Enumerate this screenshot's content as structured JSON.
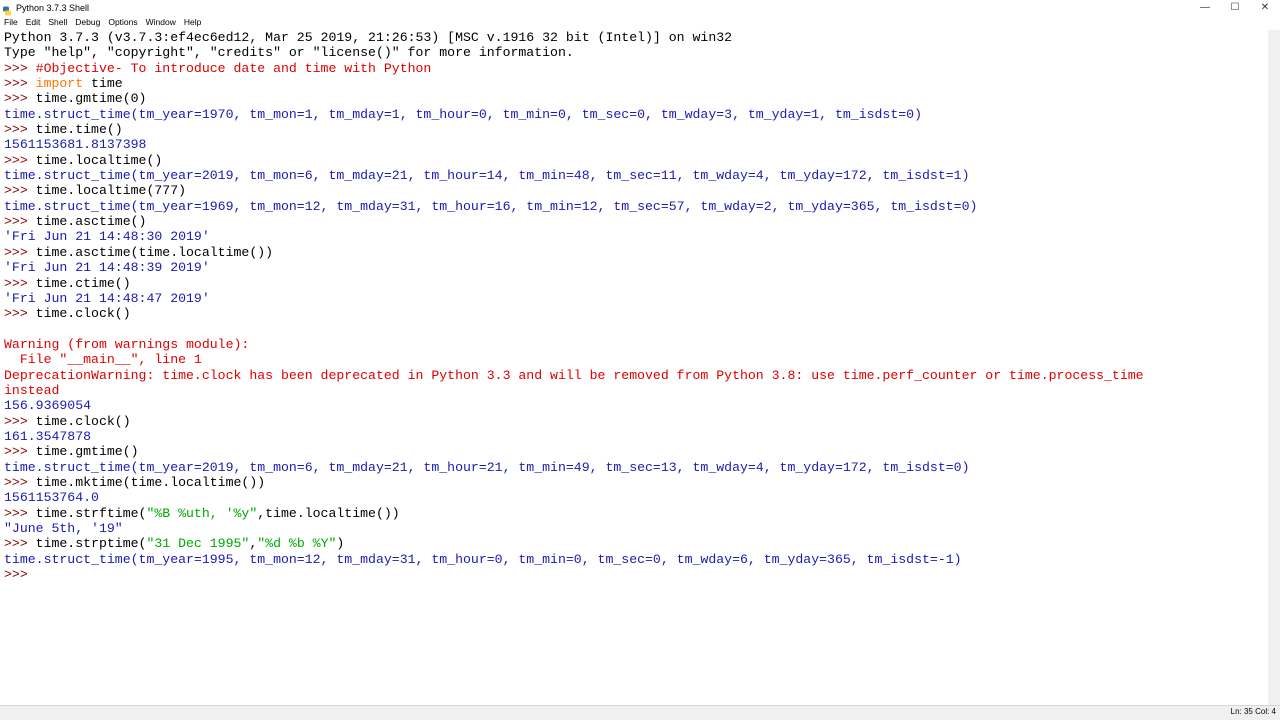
{
  "window": {
    "title": "Python 3.7.3 Shell",
    "controls": {
      "minimize": "—",
      "maximize": "☐",
      "close": "✕"
    }
  },
  "menu": [
    "File",
    "Edit",
    "Shell",
    "Debug",
    "Options",
    "Window",
    "Help"
  ],
  "shell": {
    "lines": [
      [
        {
          "t": "Python 3.7.3 (v3.7.3:ef4ec6ed12, Mar 25 2019, 21:26:53) [MSC v.1916 32 bit (Intel)] on win32",
          "c": ""
        }
      ],
      [
        {
          "t": "Type \"help\", \"copyright\", \"credits\" or \"license()\" for more information.",
          "c": ""
        }
      ],
      [
        {
          "t": ">>> ",
          "c": "prompt"
        },
        {
          "t": "#Objective- To introduce date and time with Python",
          "c": "cmt"
        }
      ],
      [
        {
          "t": ">>> ",
          "c": "prompt"
        },
        {
          "t": "import",
          "c": "kw"
        },
        {
          "t": " time",
          "c": ""
        }
      ],
      [
        {
          "t": ">>> ",
          "c": "prompt"
        },
        {
          "t": "time.gmtime(0)",
          "c": ""
        }
      ],
      [
        {
          "t": "time.struct_time(tm_year=1970, tm_mon=1, tm_mday=1, tm_hour=0, tm_min=0, tm_sec=0, tm_wday=3, tm_yday=1, tm_isdst=0)",
          "c": "out"
        }
      ],
      [
        {
          "t": ">>> ",
          "c": "prompt"
        },
        {
          "t": "time.time()",
          "c": ""
        }
      ],
      [
        {
          "t": "1561153681.8137398",
          "c": "out"
        }
      ],
      [
        {
          "t": ">>> ",
          "c": "prompt"
        },
        {
          "t": "time.localtime()",
          "c": ""
        }
      ],
      [
        {
          "t": "time.struct_time(tm_year=2019, tm_mon=6, tm_mday=21, tm_hour=14, tm_min=48, tm_sec=11, tm_wday=4, tm_yday=172, tm_isdst=1)",
          "c": "out"
        }
      ],
      [
        {
          "t": ">>> ",
          "c": "prompt"
        },
        {
          "t": "time.localtime(777)",
          "c": ""
        }
      ],
      [
        {
          "t": "time.struct_time(tm_year=1969, tm_mon=12, tm_mday=31, tm_hour=16, tm_min=12, tm_sec=57, tm_wday=2, tm_yday=365, tm_isdst=0)",
          "c": "out"
        }
      ],
      [
        {
          "t": ">>> ",
          "c": "prompt"
        },
        {
          "t": "time.asctime()",
          "c": ""
        }
      ],
      [
        {
          "t": "'Fri Jun 21 14:48:30 2019'",
          "c": "out"
        }
      ],
      [
        {
          "t": ">>> ",
          "c": "prompt"
        },
        {
          "t": "time.asctime(time.localtime())",
          "c": ""
        }
      ],
      [
        {
          "t": "'Fri Jun 21 14:48:39 2019'",
          "c": "out"
        }
      ],
      [
        {
          "t": ">>> ",
          "c": "prompt"
        },
        {
          "t": "time.ctime()",
          "c": ""
        }
      ],
      [
        {
          "t": "'Fri Jun 21 14:48:47 2019'",
          "c": "out"
        }
      ],
      [
        {
          "t": ">>> ",
          "c": "prompt"
        },
        {
          "t": "time.clock()",
          "c": ""
        }
      ],
      [
        {
          "t": "",
          "c": ""
        }
      ],
      [
        {
          "t": "Warning (from warnings module):",
          "c": "err"
        }
      ],
      [
        {
          "t": "  File \"__main__\", line 1",
          "c": "err"
        }
      ],
      [
        {
          "t": "DeprecationWarning: time.clock has been deprecated in Python 3.3 and will be removed from Python 3.8: use time.perf_counter or time.process_time",
          "c": "err"
        }
      ],
      [
        {
          "t": "instead",
          "c": "err"
        }
      ],
      [
        {
          "t": "156.9369054",
          "c": "out"
        }
      ],
      [
        {
          "t": ">>> ",
          "c": "prompt"
        },
        {
          "t": "time.clock()",
          "c": ""
        }
      ],
      [
        {
          "t": "161.3547878",
          "c": "out"
        }
      ],
      [
        {
          "t": ">>> ",
          "c": "prompt"
        },
        {
          "t": "time.gmtime()",
          "c": ""
        }
      ],
      [
        {
          "t": "time.struct_time(tm_year=2019, tm_mon=6, tm_mday=21, tm_hour=21, tm_min=49, tm_sec=13, tm_wday=4, tm_yday=172, tm_isdst=0)",
          "c": "out"
        }
      ],
      [
        {
          "t": ">>> ",
          "c": "prompt"
        },
        {
          "t": "time.mktime(time.localtime())",
          "c": ""
        }
      ],
      [
        {
          "t": "1561153764.0",
          "c": "out"
        }
      ],
      [
        {
          "t": ">>> ",
          "c": "prompt"
        },
        {
          "t": "time.strftime(",
          "c": ""
        },
        {
          "t": "\"%B %uth, '%y\"",
          "c": "str"
        },
        {
          "t": ",time.localtime())",
          "c": ""
        }
      ],
      [
        {
          "t": "\"June 5th, '19\"",
          "c": "out"
        }
      ],
      [
        {
          "t": ">>> ",
          "c": "prompt"
        },
        {
          "t": "time.strptime(",
          "c": ""
        },
        {
          "t": "\"31 Dec 1995\"",
          "c": "str"
        },
        {
          "t": ",",
          "c": ""
        },
        {
          "t": "\"%d %b %Y\"",
          "c": "str"
        },
        {
          "t": ")",
          "c": ""
        }
      ],
      [
        {
          "t": "time.struct_time(tm_year=1995, tm_mon=12, tm_mday=31, tm_hour=0, tm_min=0, tm_sec=0, tm_wday=6, tm_yday=365, tm_isdst=-1)",
          "c": "out"
        }
      ],
      [
        {
          "t": ">>> ",
          "c": "prompt"
        }
      ]
    ]
  },
  "status": {
    "position": "Ln: 35   Col: 4"
  },
  "colors": {
    "output": "#1a1ab5",
    "error": "#e00000",
    "keyword": "#ff7700",
    "string": "#00aa00",
    "comment": "#dd0000",
    "prompt": "#8b0000"
  }
}
